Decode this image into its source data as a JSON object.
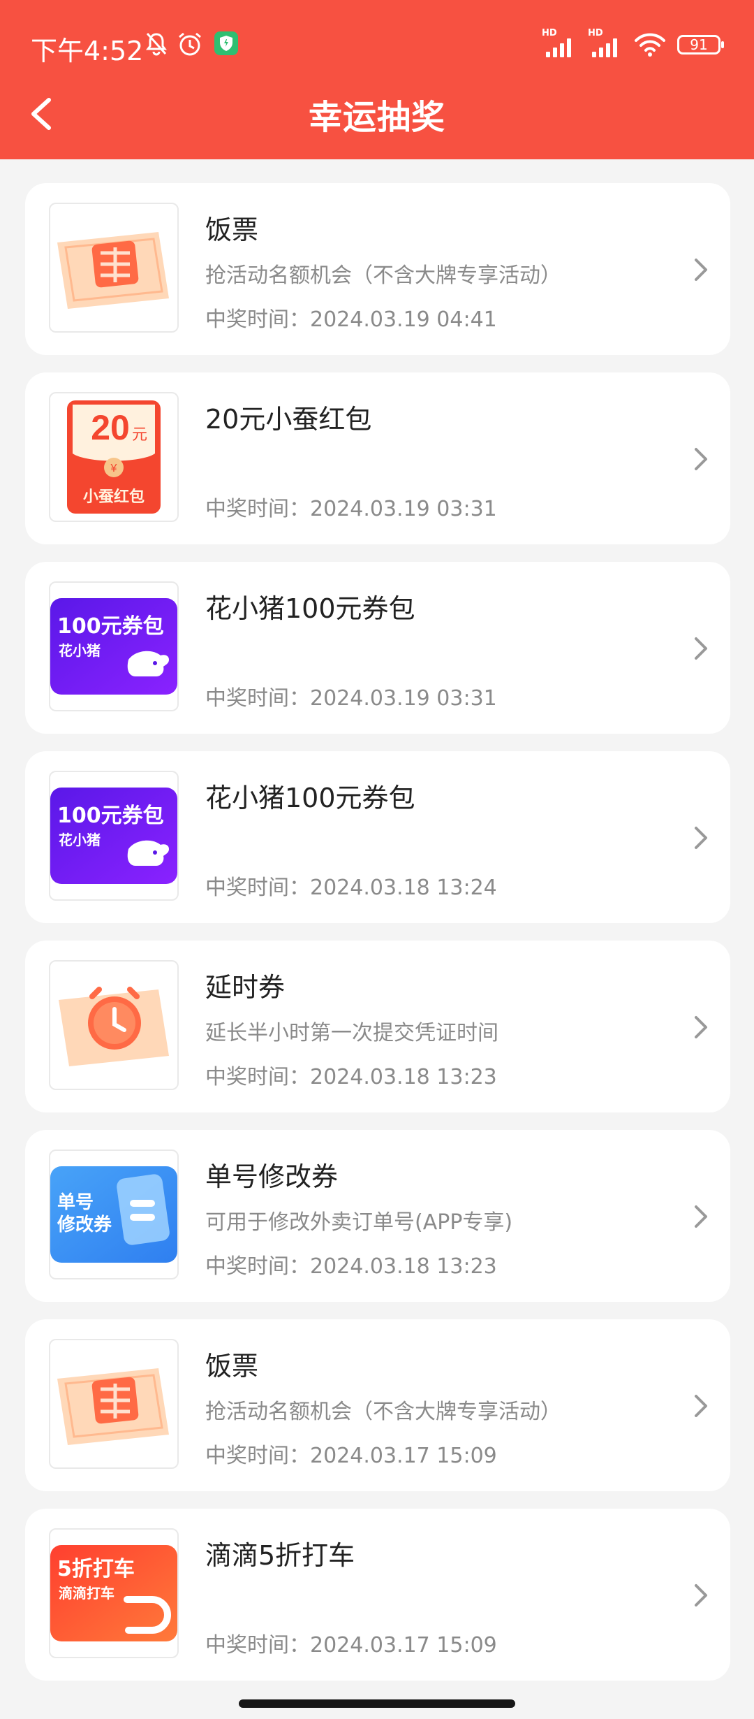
{
  "status_bar": {
    "time": "下午4:52",
    "battery": "91",
    "hd_label": "HD"
  },
  "header": {
    "title": "幸运抽奖"
  },
  "items": [
    {
      "title": "饭票",
      "subtitle": "抢活动名额机会（不含大牌专享活动）",
      "time": "中奖时间：2024.03.19 04:41",
      "thumb": "meal-ticket"
    },
    {
      "title": "20元小蚕红包",
      "subtitle": "",
      "time": "中奖时间：2024.03.19 03:31",
      "thumb": "red-packet",
      "thumb_amount": "20",
      "thumb_unit": "元",
      "thumb_caption": "小蚕红包",
      "thumb_yen": "¥"
    },
    {
      "title": "花小猪100元券包",
      "subtitle": "",
      "time": "中奖时间：2024.03.19 03:31",
      "thumb": "coupon-pack",
      "thumb_line1": "100元券包",
      "thumb_line2": "花小猪"
    },
    {
      "title": "花小猪100元券包",
      "subtitle": "",
      "time": "中奖时间：2024.03.18 13:24",
      "thumb": "coupon-pack",
      "thumb_line1": "100元券包",
      "thumb_line2": "花小猪"
    },
    {
      "title": "延时券",
      "subtitle": "延长半小时第一次提交凭证时间",
      "time": "中奖时间：2024.03.18 13:23",
      "thumb": "clock-ticket"
    },
    {
      "title": "单号修改券",
      "subtitle": "可用于修改外卖订单号(APP专享)",
      "time": "中奖时间：2024.03.18 13:23",
      "thumb": "order-edit",
      "thumb_line1": "单号",
      "thumb_line2": "修改券"
    },
    {
      "title": "饭票",
      "subtitle": "抢活动名额机会（不含大牌专享活动）",
      "time": "中奖时间：2024.03.17 15:09",
      "thumb": "meal-ticket"
    },
    {
      "title": "滴滴5折打车",
      "subtitle": "",
      "time": "中奖时间：2024.03.17 15:09",
      "thumb": "didi",
      "thumb_line1": "5折打车",
      "thumb_line2": "滴滴打车"
    }
  ],
  "colors": {
    "header_red": "#f75141",
    "coupon_purple": "#6a12f0",
    "order_blue": "#4da2f7",
    "didi_orange": "#ff5a2a"
  }
}
